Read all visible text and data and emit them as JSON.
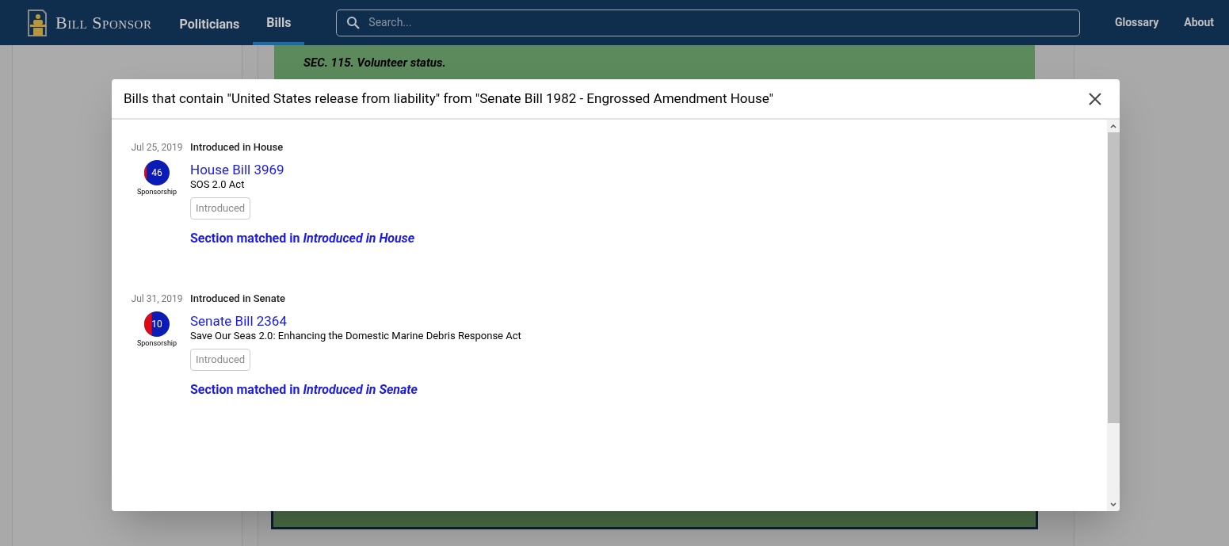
{
  "navbar": {
    "brand": "Bill Sponsor",
    "links": [
      {
        "label": "Politicians",
        "selected": false
      },
      {
        "label": "Bills",
        "selected": true
      }
    ],
    "search": {
      "placeholder": "Search..."
    },
    "right_links": [
      "Glossary",
      "About"
    ]
  },
  "background": {
    "section_heading": "SEC. 115. Volunteer status."
  },
  "dialog": {
    "title": "Bills that contain \"United States release from liability\" from \"Senate Bill 1982 - Engrossed Amendment House\"",
    "results": [
      {
        "date": "Jul 25, 2019",
        "version": "Introduced in House",
        "sponsorship": {
          "count": "46",
          "level": 0.1,
          "label": "Sponsorship"
        },
        "bill": "House Bill 3969",
        "short_title": "SOS 2.0 Act",
        "status": "Introduced",
        "match": "Section matched in *Introduced in House*"
      },
      {
        "date": "Jul 31, 2019",
        "version": "Introduced in Senate",
        "sponsorship": {
          "count": "10",
          "level": 0.3,
          "label": "Sponsorship"
        },
        "bill": "Senate Bill 2364",
        "short_title": "Save Our Seas 2.0: Enhancing the Domestic Marine Debris Response Act",
        "status": "Introduced",
        "match": "Section matched in *Introduced in Senate*"
      }
    ]
  }
}
